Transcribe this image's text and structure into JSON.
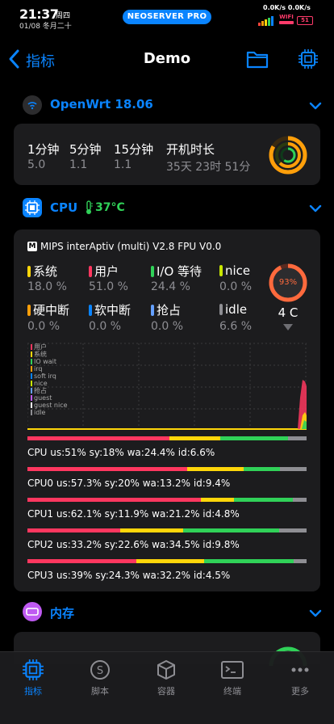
{
  "status_bar": {
    "time": "21:37",
    "weekday": "周四",
    "date": "01/08 冬月二十",
    "app_pill": "NEOSERVER PRO",
    "net_speed": "0.0K/s 0.0K/s",
    "wifi_label": "WIFI",
    "battery": "51"
  },
  "nav": {
    "back_label": "指标",
    "title": "Demo"
  },
  "openwrt": {
    "title": "OpenWrt 18.06",
    "load_headers": [
      "1分钟",
      "5分钟",
      "15分钟",
      "开机时长"
    ],
    "load_values": [
      "5.0",
      "1.1",
      "1.1",
      "35天 23时 51分"
    ]
  },
  "cpu_section": {
    "title": "CPU",
    "temp": "37°C",
    "model": "MIPS interAptiv (multi) V2.8  FPU V0.0",
    "stats": [
      {
        "label": "系统",
        "value": "18.0 %",
        "color": "#ffd60a"
      },
      {
        "label": "用户",
        "value": "51.0 %",
        "color": "#ff375f"
      },
      {
        "label": "I/O 等待",
        "value": "24.4 %",
        "color": "#30d158"
      },
      {
        "label": "nice",
        "value": "0.0 %",
        "color": "#c8e600"
      },
      {
        "label": "硬中断",
        "value": "0.0 %",
        "color": "#ff9f0a"
      },
      {
        "label": "软中断",
        "value": "0.0 %",
        "color": "#0a84ff"
      },
      {
        "label": "抢占",
        "value": "0.0 %",
        "color": "#64a0ff"
      },
      {
        "label": "idle",
        "value": "6.6 %",
        "color": "#8e8e93"
      }
    ],
    "gauge_percent": "93%",
    "gauge_fraction": 0.93,
    "cores_label": "4 C",
    "chart_legend": [
      {
        "label": "用户",
        "color": "#ff375f"
      },
      {
        "label": "系统",
        "color": "#ffd60a"
      },
      {
        "label": "IO wait",
        "color": "#30d158"
      },
      {
        "label": "irq",
        "color": "#ff9f0a"
      },
      {
        "label": "soft irq",
        "color": "#0a84ff"
      },
      {
        "label": "nice",
        "color": "#c8e600"
      },
      {
        "label": "抢占",
        "color": "#64a0ff"
      },
      {
        "label": "guest",
        "color": "#bf5af2"
      },
      {
        "label": "guest nice",
        "color": "#ffffff"
      },
      {
        "label": "idle",
        "color": "#8e8e93"
      }
    ],
    "cpus": [
      {
        "text": "CPU us:51% sy:18% wa:24.4% id:6.6%",
        "us": 51,
        "sy": 18,
        "wa": 24.4,
        "id": 6.6
      },
      {
        "text": "CPU0 us:57.3% sy:20% wa:13.2% id:9.4%",
        "us": 57.3,
        "sy": 20,
        "wa": 13.2,
        "id": 9.4
      },
      {
        "text": "CPU1 us:62.1% sy:11.9% wa:21.2% id:4.8%",
        "us": 62.1,
        "sy": 11.9,
        "wa": 21.2,
        "id": 4.8
      },
      {
        "text": "CPU2 us:33.2% sy:22.6% wa:34.5% id:9.8%",
        "us": 33.2,
        "sy": 22.6,
        "wa": 34.5,
        "id": 9.8
      },
      {
        "text": "CPU3 us:39% sy:24.3% wa:32.2% id:4.5%",
        "us": 39,
        "sy": 24.3,
        "wa": 32.2,
        "id": 4.5
      }
    ]
  },
  "memory": {
    "title": "内存"
  },
  "tabbar": {
    "tabs": [
      {
        "label": "指标",
        "icon": "chip-icon",
        "active": true
      },
      {
        "label": "脚本",
        "icon": "script-icon",
        "active": false
      },
      {
        "label": "容器",
        "icon": "box-icon",
        "active": false
      },
      {
        "label": "终端",
        "icon": "terminal-icon",
        "active": false
      },
      {
        "label": "更多",
        "icon": "more-icon",
        "active": false
      }
    ]
  },
  "colors": {
    "accent": "#0a84ff",
    "user": "#ff375f",
    "system": "#ffd60a",
    "iowait": "#30d158",
    "idle": "#8e8e93"
  }
}
